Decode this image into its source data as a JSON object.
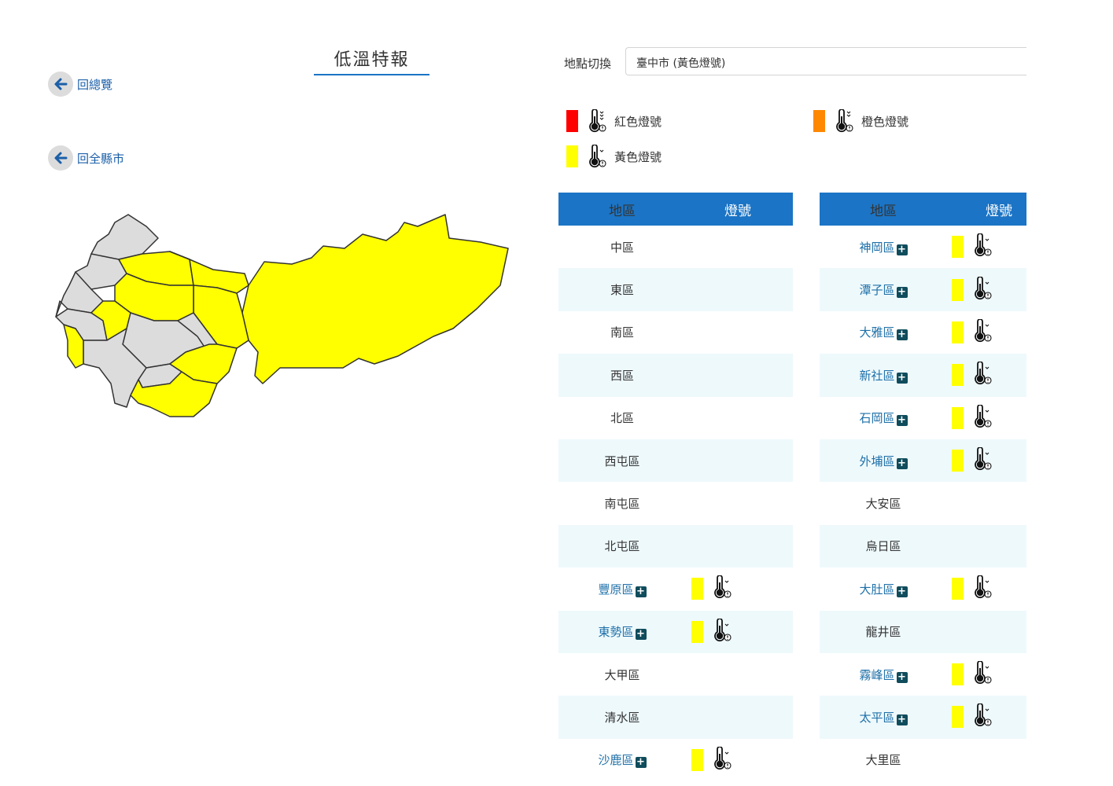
{
  "page_title": "低溫特報",
  "nav": {
    "back_overview": "回總覽",
    "back_county": "回全縣市"
  },
  "location": {
    "label": "地點切換",
    "selected": "臺中市 (黃色燈號)"
  },
  "legend": [
    {
      "label": "紅色燈號",
      "color": "#ff0000"
    },
    {
      "label": "橙色燈號",
      "color": "#ff8800"
    },
    {
      "label": "黃色燈號",
      "color": "#ffff00"
    }
  ],
  "table_headers": {
    "area": "地區",
    "signal": "燈號"
  },
  "left_rows": [
    {
      "name": "中區",
      "warn": false
    },
    {
      "name": "東區",
      "warn": false
    },
    {
      "name": "南區",
      "warn": false
    },
    {
      "name": "西區",
      "warn": false
    },
    {
      "name": "北區",
      "warn": false
    },
    {
      "name": "西屯區",
      "warn": false
    },
    {
      "name": "南屯區",
      "warn": false
    },
    {
      "name": "北屯區",
      "warn": false
    },
    {
      "name": "豐原區",
      "warn": true
    },
    {
      "name": "東勢區",
      "warn": true
    },
    {
      "name": "大甲區",
      "warn": false
    },
    {
      "name": "清水區",
      "warn": false
    },
    {
      "name": "沙鹿區",
      "warn": true
    }
  ],
  "right_rows": [
    {
      "name": "神岡區",
      "warn": true
    },
    {
      "name": "潭子區",
      "warn": true
    },
    {
      "name": "大雅區",
      "warn": true
    },
    {
      "name": "新社區",
      "warn": true
    },
    {
      "name": "石岡區",
      "warn": true
    },
    {
      "name": "外埔區",
      "warn": true
    },
    {
      "name": "大安區",
      "warn": false
    },
    {
      "name": "烏日區",
      "warn": false
    },
    {
      "name": "大肚區",
      "warn": true
    },
    {
      "name": "龍井區",
      "warn": false
    },
    {
      "name": "霧峰區",
      "warn": true
    },
    {
      "name": "太平區",
      "warn": true
    },
    {
      "name": "大里區",
      "warn": false
    }
  ],
  "colors": {
    "header_blue": "#1b74c5",
    "warning_yellow": "#ffff00",
    "map_gray": "#dcdcdc"
  },
  "icons": {
    "back": "arrow-left-icon",
    "signal": "thermometer-low-icon",
    "expand": "plus-square-icon"
  }
}
